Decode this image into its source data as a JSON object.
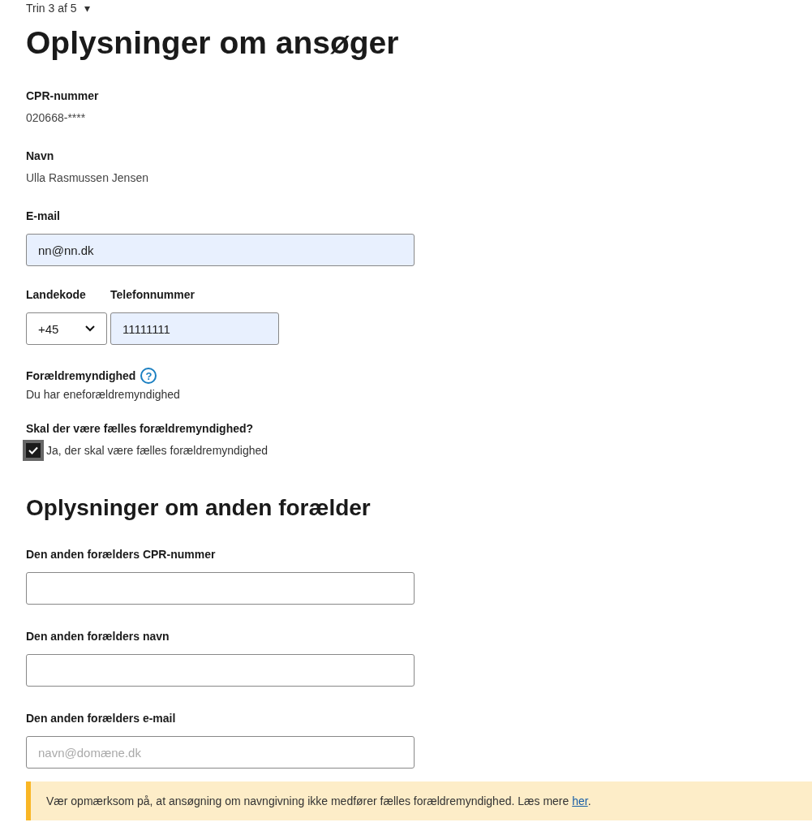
{
  "step": {
    "label": "Trin 3 af 5",
    "icon": "▾"
  },
  "applicant": {
    "heading": "Oplysninger om ansøger",
    "readonly_fields": [
      {
        "label": "CPR-nummer",
        "value": "020668-****"
      },
      {
        "label": "Navn",
        "value": "Ulla Rasmussen Jensen"
      }
    ],
    "email": {
      "label": "E-mail",
      "value": "nn@nn.dk",
      "autofilled": true
    },
    "country_code": {
      "label": "Landekode",
      "value": "+45"
    },
    "phone": {
      "label": "Telefonnummer",
      "value": "11111111",
      "autofilled": true
    },
    "custody": {
      "label": "Forældremyndighed",
      "help_icon": "?",
      "value": "Du har eneforældremyndighed"
    },
    "joint_custody": {
      "question": "Skal der være fælles forældremyndighed?",
      "option": "Ja, der skal være fælles forældremyndighed",
      "checked": true
    }
  },
  "other_parent": {
    "heading": "Oplysninger om anden forælder",
    "fields": [
      {
        "label": "Den anden forælders CPR-nummer"
      },
      {
        "label": "Den anden forælders navn"
      },
      {
        "label": "Den anden forælders e-mail",
        "placeholder": "navn@domæne.dk"
      }
    ]
  },
  "notice": {
    "text": "Vær opmærksom på, at ansøgning om navngivning ikke medfører fælles forældremyndighed. Læs mere ",
    "link": "her",
    "text_after": "."
  }
}
